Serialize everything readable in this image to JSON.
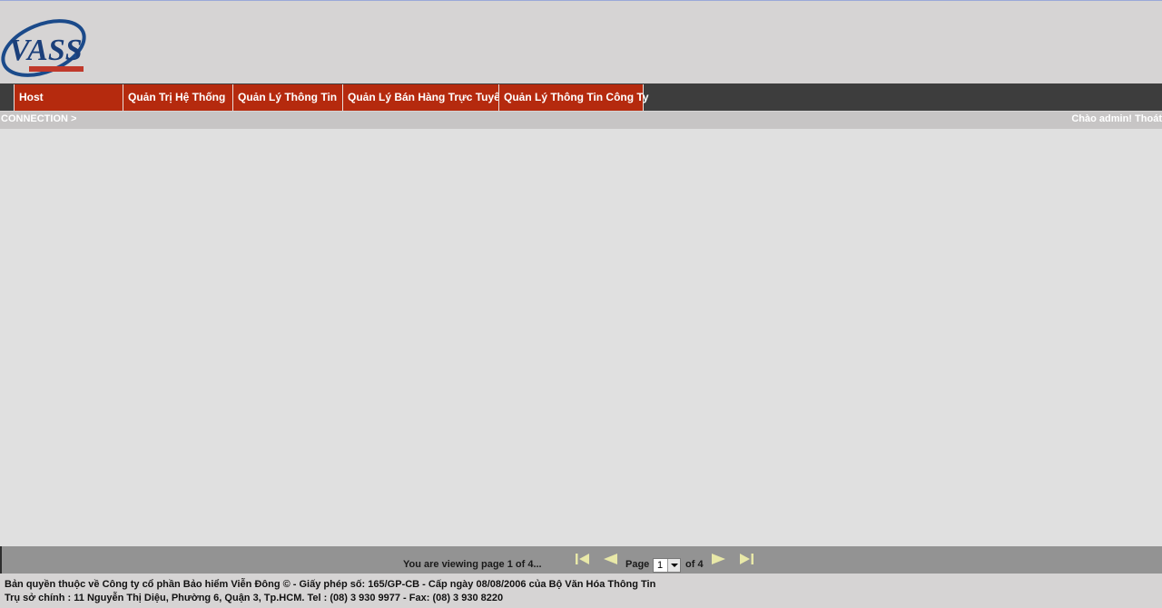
{
  "header": {
    "logo_text": "VASS"
  },
  "nav": {
    "tabs": [
      {
        "label": "Host",
        "width": 120
      },
      {
        "label": "Quản Trị Hệ Thống",
        "width": 121
      },
      {
        "label": "Quản Lý Thông Tin",
        "width": 121
      },
      {
        "label": "Quản Lý Bán Hàng Trực Tuyến",
        "width": 172
      },
      {
        "label": "Quản Lý Thông Tin Công Ty",
        "width": 160
      }
    ]
  },
  "breadcrumb": {
    "text": "CONNECTION >"
  },
  "user": {
    "greeting": "Chào admin!",
    "logout": "Thoát"
  },
  "pager": {
    "status": "You are viewing page 1 of 4...",
    "page_label": "Page",
    "current": "1",
    "of_label": "of 4"
  },
  "footer": {
    "line1": "Bản quyền thuộc về Công ty cổ phần Bảo hiểm Viễn Đông © - Giấy phép số: 165/GP-CB - Cấp ngày 08/08/2006 của Bộ Văn Hóa Thông Tin",
    "line2": "Trụ sở chính : 11 Nguyễn Thị Diệu, Phường 6, Quận 3, Tp.HCM. Tel : (08) 3 930 9977 - Fax: (08) 3 930 8220"
  },
  "colors": {
    "nav_tab": "#b52a0e",
    "navbar": "#3d3d3d",
    "pager": "#939393",
    "content": "#e0e0e0"
  }
}
